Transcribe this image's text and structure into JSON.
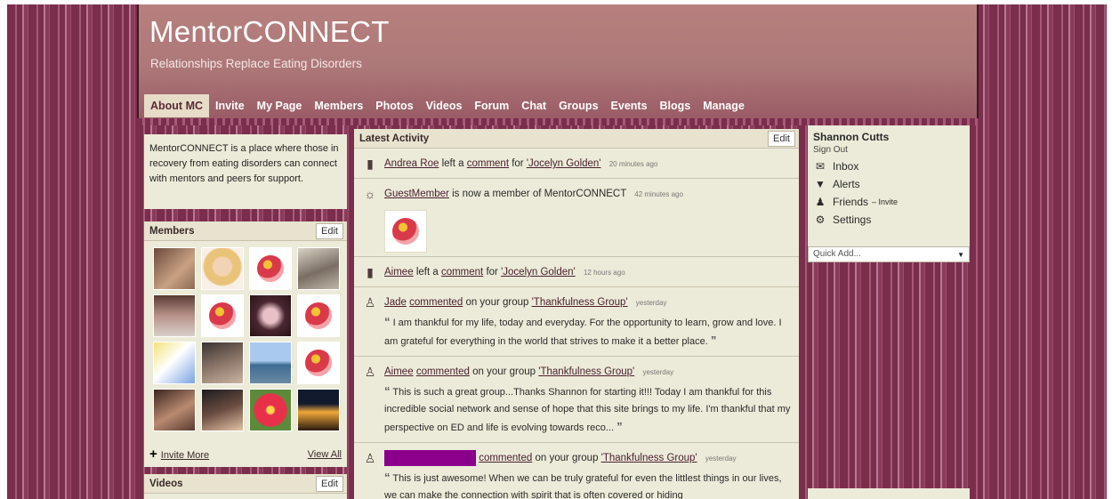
{
  "site": {
    "title": "MentorCONNECT",
    "tagline": "Relationships Replace Eating Disorders"
  },
  "nav": {
    "tabs": [
      "About MC",
      "Invite",
      "My Page",
      "Members",
      "Photos",
      "Videos",
      "Forum",
      "Chat",
      "Groups",
      "Events",
      "Blogs",
      "Manage"
    ],
    "active": "About MC"
  },
  "about": {
    "text": "MentorCONNECT is a place where those in recovery from eating disorders can connect with mentors and peers for support."
  },
  "members": {
    "title": "Members",
    "edit_label": "Edit",
    "invite_more": "Invite More",
    "view_all": "View All"
  },
  "videos": {
    "title": "Videos",
    "edit_label": "Edit"
  },
  "activity": {
    "title": "Latest Activity",
    "edit_label": "Edit",
    "items": [
      {
        "actor": "Andrea Roe",
        "verb": "left a",
        "link": "comment",
        "prep": "for",
        "target": "'Jocelyn Golden'",
        "time": "20 minutes ago"
      },
      {
        "actor": "GuestMember",
        "text": "is now a member of MentorCONNECT",
        "time": "42 minutes ago"
      },
      {
        "actor": "Aimee",
        "verb": "left a",
        "link": "comment",
        "prep": "for",
        "target": "'Jocelyn Golden'",
        "time": "12 hours ago"
      },
      {
        "actor": "Jade",
        "link": "commented",
        "prep": "on your group",
        "target": "'Thankfulness Group'",
        "time": "yesterday",
        "quote": "I am thankful for my life, today and everyday. For the opportunity to learn, grow and love. I am grateful for everything in the world that strives to make it a better place."
      },
      {
        "actor": "Aimee",
        "link": "commented",
        "prep": "on your group",
        "target": "'Thankfulness Group'",
        "time": "yesterday",
        "quote": "This is such a great group...Thanks Shannon for starting it!!! Today I am thankful for this incredible social network and sense of hope that this site brings to my life. I'm thankful that my perspective on ED and life is evolving towards reco..."
      },
      {
        "link": "commented",
        "prep": "on your group",
        "target": "'Thankfulness Group'",
        "time": "yesterday",
        "quote": "This is just awesome! When we can be truly grateful for even the littlest things in our lives, we can make the connection with spirit that is often covered or hiding"
      }
    ]
  },
  "user": {
    "name": "Shannon Cutts",
    "sign_out": "Sign Out",
    "menu": [
      {
        "label": "Inbox",
        "icon": "envelope-icon"
      },
      {
        "label": "Alerts",
        "icon": "alert-icon"
      },
      {
        "label": "Friends",
        "icon": "friends-icon",
        "extra": "– Invite"
      },
      {
        "label": "Settings",
        "icon": "settings-icon"
      }
    ],
    "quick_add": "Quick Add..."
  }
}
